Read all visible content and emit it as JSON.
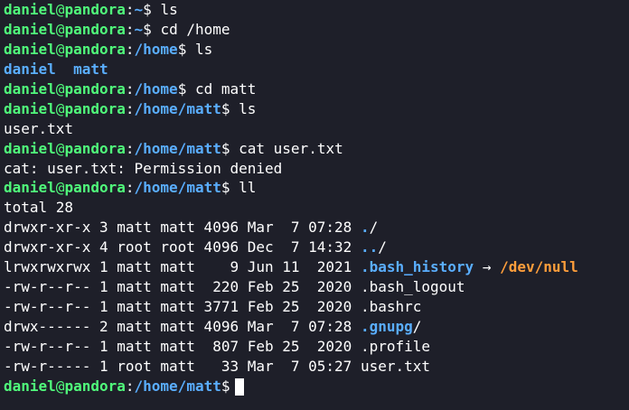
{
  "prompt": {
    "user": "daniel",
    "at": "@",
    "host": "pandora",
    "sep": ":"
  },
  "lines": [
    {
      "type": "prompt",
      "path": "~",
      "cmd": "ls"
    },
    {
      "type": "prompt",
      "path": "~",
      "cmd": "cd /home"
    },
    {
      "type": "prompt",
      "path": "/home",
      "cmd": "ls"
    },
    {
      "type": "dirs",
      "items": [
        "daniel",
        "matt"
      ]
    },
    {
      "type": "prompt",
      "path": "/home",
      "cmd": "cd matt"
    },
    {
      "type": "prompt",
      "path": "/home/matt",
      "cmd": "ls"
    },
    {
      "type": "text",
      "text": "user.txt"
    },
    {
      "type": "prompt",
      "path": "/home/matt",
      "cmd": "cat user.txt"
    },
    {
      "type": "text",
      "text": "cat: user.txt: Permission denied"
    },
    {
      "type": "prompt",
      "path": "/home/matt",
      "cmd": "ll"
    },
    {
      "type": "text",
      "text": "total 28"
    },
    {
      "type": "ls",
      "perms": "drwxr-xr-x",
      "meta": " 3 matt matt 4096 Mar  7 07:28 ",
      "name": ".",
      "kind": "dir",
      "suffix": "/"
    },
    {
      "type": "ls",
      "perms": "drwxr-xr-x",
      "meta": " 4 root root 4096 Dec  7 14:32 ",
      "name": "..",
      "kind": "dir",
      "suffix": "/"
    },
    {
      "type": "ls",
      "perms": "lrwxrwxrwx",
      "meta": " 1 matt matt    9 Jun 11  2021 ",
      "name": ".bash_history",
      "kind": "link",
      "arrow": " → ",
      "target": "/dev/null"
    },
    {
      "type": "ls",
      "perms": "-rw-r--r--",
      "meta": " 1 matt matt  220 Feb 25  2020 ",
      "name": ".bash_logout",
      "kind": "file"
    },
    {
      "type": "ls",
      "perms": "-rw-r--r--",
      "meta": " 1 matt matt 3771 Feb 25  2020 ",
      "name": ".bashrc",
      "kind": "file"
    },
    {
      "type": "ls",
      "perms": "drwx------",
      "meta": " 2 matt matt 4096 Mar  7 07:28 ",
      "name": ".gnupg",
      "kind": "dir",
      "suffix": "/"
    },
    {
      "type": "ls",
      "perms": "-rw-r--r--",
      "meta": " 1 matt matt  807 Feb 25  2020 ",
      "name": ".profile",
      "kind": "file"
    },
    {
      "type": "ls",
      "perms": "-rw-r-----",
      "meta": " 1 root matt   33 Mar  7 05:27 ",
      "name": "user.txt",
      "kind": "file"
    },
    {
      "type": "prompt",
      "path": "/home/matt",
      "cmd": "",
      "active": true
    }
  ]
}
